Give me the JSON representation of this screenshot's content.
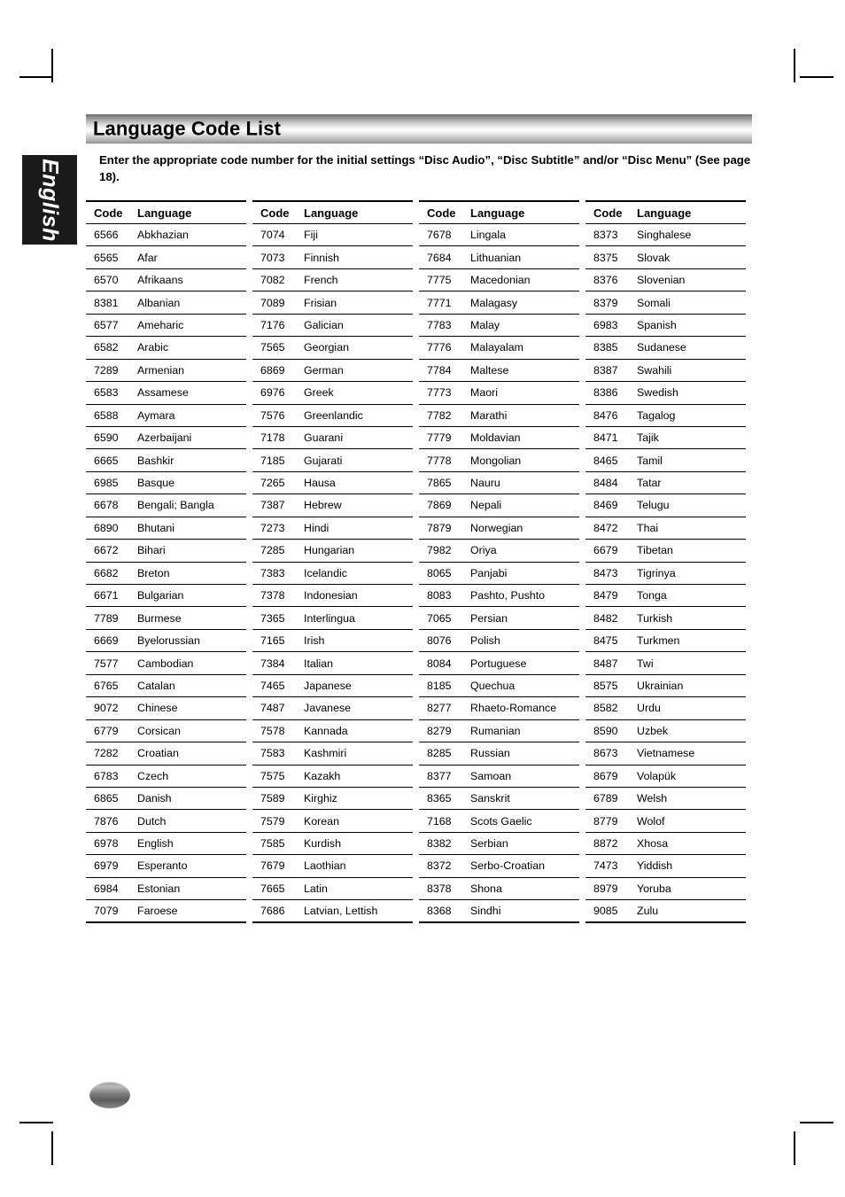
{
  "document": {
    "title": "Language Code List",
    "side_tab_label": "English",
    "intro": "Enter the appropriate code number for the initial settings “Disc Audio”, “Disc Subtitle” and/or “Disc Menu” (See page 18).",
    "accent_color": "#1a1a1a",
    "rule_color": "#000000"
  },
  "table": {
    "headers": {
      "code": "Code",
      "language": "Language"
    },
    "columns": [
      {
        "rows": [
          {
            "code": "6566",
            "language": "Abkhazian"
          },
          {
            "code": "6565",
            "language": "Afar"
          },
          {
            "code": "6570",
            "language": "Afrikaans"
          },
          {
            "code": "8381",
            "language": "Albanian"
          },
          {
            "code": "6577",
            "language": "Ameharic"
          },
          {
            "code": "6582",
            "language": "Arabic"
          },
          {
            "code": "7289",
            "language": "Armenian"
          },
          {
            "code": "6583",
            "language": "Assamese"
          },
          {
            "code": "6588",
            "language": "Aymara"
          },
          {
            "code": "6590",
            "language": "Azerbaijani"
          },
          {
            "code": "6665",
            "language": "Bashkir"
          },
          {
            "code": "6985",
            "language": "Basque"
          },
          {
            "code": "6678",
            "language": "Bengali; Bangla"
          },
          {
            "code": "6890",
            "language": "Bhutani"
          },
          {
            "code": "6672",
            "language": "Bihari"
          },
          {
            "code": "6682",
            "language": "Breton"
          },
          {
            "code": "6671",
            "language": "Bulgarian"
          },
          {
            "code": "7789",
            "language": "Burmese"
          },
          {
            "code": "6669",
            "language": "Byelorussian"
          },
          {
            "code": "7577",
            "language": "Cambodian"
          },
          {
            "code": "6765",
            "language": "Catalan"
          },
          {
            "code": "9072",
            "language": "Chinese"
          },
          {
            "code": "6779",
            "language": "Corsican"
          },
          {
            "code": "7282",
            "language": "Croatian"
          },
          {
            "code": "6783",
            "language": "Czech"
          },
          {
            "code": "6865",
            "language": "Danish"
          },
          {
            "code": "7876",
            "language": "Dutch"
          },
          {
            "code": "6978",
            "language": "English"
          },
          {
            "code": "6979",
            "language": "Esperanto"
          },
          {
            "code": "6984",
            "language": "Estonian"
          },
          {
            "code": "7079",
            "language": "Faroese"
          }
        ]
      },
      {
        "rows": [
          {
            "code": "7074",
            "language": "Fiji"
          },
          {
            "code": "7073",
            "language": "Finnish"
          },
          {
            "code": "7082",
            "language": "French"
          },
          {
            "code": "7089",
            "language": "Frisian"
          },
          {
            "code": "7176",
            "language": "Galician"
          },
          {
            "code": "7565",
            "language": "Georgian"
          },
          {
            "code": "6869",
            "language": "German"
          },
          {
            "code": "6976",
            "language": "Greek"
          },
          {
            "code": "7576",
            "language": "Greenlandic"
          },
          {
            "code": "7178",
            "language": "Guarani"
          },
          {
            "code": "7185",
            "language": "Gujarati"
          },
          {
            "code": "7265",
            "language": "Hausa"
          },
          {
            "code": "7387",
            "language": "Hebrew"
          },
          {
            "code": "7273",
            "language": "Hindi"
          },
          {
            "code": "7285",
            "language": "Hungarian"
          },
          {
            "code": "7383",
            "language": "Icelandic"
          },
          {
            "code": "7378",
            "language": "Indonesian"
          },
          {
            "code": "7365",
            "language": "Interlingua"
          },
          {
            "code": "7165",
            "language": "Irish"
          },
          {
            "code": "7384",
            "language": "Italian"
          },
          {
            "code": "7465",
            "language": "Japanese"
          },
          {
            "code": "7487",
            "language": "Javanese"
          },
          {
            "code": "7578",
            "language": "Kannada"
          },
          {
            "code": "7583",
            "language": "Kashmiri"
          },
          {
            "code": "7575",
            "language": "Kazakh"
          },
          {
            "code": "7589",
            "language": "Kirghiz"
          },
          {
            "code": "7579",
            "language": "Korean"
          },
          {
            "code": "7585",
            "language": "Kurdish"
          },
          {
            "code": "7679",
            "language": "Laothian"
          },
          {
            "code": "7665",
            "language": "Latin"
          },
          {
            "code": "7686",
            "language": "Latvian, Lettish"
          }
        ]
      },
      {
        "rows": [
          {
            "code": "7678",
            "language": "Lingala"
          },
          {
            "code": "7684",
            "language": "Lithuanian"
          },
          {
            "code": "7775",
            "language": "Macedonian"
          },
          {
            "code": "7771",
            "language": "Malagasy"
          },
          {
            "code": "7783",
            "language": "Malay"
          },
          {
            "code": "7776",
            "language": "Malayalam"
          },
          {
            "code": "7784",
            "language": "Maltese"
          },
          {
            "code": "7773",
            "language": "Maori"
          },
          {
            "code": "7782",
            "language": "Marathi"
          },
          {
            "code": "7779",
            "language": "Moldavian"
          },
          {
            "code": "7778",
            "language": "Mongolian"
          },
          {
            "code": "7865",
            "language": "Nauru"
          },
          {
            "code": "7869",
            "language": "Nepali"
          },
          {
            "code": "7879",
            "language": "Norwegian"
          },
          {
            "code": "7982",
            "language": "Oriya"
          },
          {
            "code": "8065",
            "language": "Panjabi"
          },
          {
            "code": "8083",
            "language": "Pashto, Pushto"
          },
          {
            "code": "7065",
            "language": "Persian"
          },
          {
            "code": "8076",
            "language": "Polish"
          },
          {
            "code": "8084",
            "language": "Portuguese"
          },
          {
            "code": "8185",
            "language": "Quechua"
          },
          {
            "code": "8277",
            "language": "Rhaeto-Romance"
          },
          {
            "code": "8279",
            "language": "Rumanian"
          },
          {
            "code": "8285",
            "language": "Russian"
          },
          {
            "code": "8377",
            "language": "Samoan"
          },
          {
            "code": "8365",
            "language": "Sanskrit"
          },
          {
            "code": "7168",
            "language": "Scots Gaelic"
          },
          {
            "code": "8382",
            "language": "Serbian"
          },
          {
            "code": "8372",
            "language": "Serbo-Croatian"
          },
          {
            "code": "8378",
            "language": "Shona"
          },
          {
            "code": "8368",
            "language": "Sindhi"
          }
        ]
      },
      {
        "rows": [
          {
            "code": "8373",
            "language": "Singhalese"
          },
          {
            "code": "8375",
            "language": "Slovak"
          },
          {
            "code": "8376",
            "language": "Slovenian"
          },
          {
            "code": "8379",
            "language": "Somali"
          },
          {
            "code": "6983",
            "language": "Spanish"
          },
          {
            "code": "8385",
            "language": "Sudanese"
          },
          {
            "code": "8387",
            "language": "Swahili"
          },
          {
            "code": "8386",
            "language": "Swedish"
          },
          {
            "code": "8476",
            "language": "Tagalog"
          },
          {
            "code": "8471",
            "language": "Tajik"
          },
          {
            "code": "8465",
            "language": "Tamil"
          },
          {
            "code": "8484",
            "language": "Tatar"
          },
          {
            "code": "8469",
            "language": "Telugu"
          },
          {
            "code": "8472",
            "language": "Thai"
          },
          {
            "code": "6679",
            "language": "Tibetan"
          },
          {
            "code": "8473",
            "language": "Tigrinya"
          },
          {
            "code": "8479",
            "language": "Tonga"
          },
          {
            "code": "8482",
            "language": "Turkish"
          },
          {
            "code": "8475",
            "language": "Turkmen"
          },
          {
            "code": "8487",
            "language": "Twi"
          },
          {
            "code": "8575",
            "language": "Ukrainian"
          },
          {
            "code": "8582",
            "language": "Urdu"
          },
          {
            "code": "8590",
            "language": "Uzbek"
          },
          {
            "code": "8673",
            "language": "Vietnamese"
          },
          {
            "code": "8679",
            "language": "Volapük"
          },
          {
            "code": "6789",
            "language": "Welsh"
          },
          {
            "code": "8779",
            "language": "Wolof"
          },
          {
            "code": "8872",
            "language": "Xhosa"
          },
          {
            "code": "7473",
            "language": "Yiddish"
          },
          {
            "code": "8979",
            "language": "Yoruba"
          },
          {
            "code": "9085",
            "language": "Zulu"
          }
        ]
      }
    ]
  }
}
